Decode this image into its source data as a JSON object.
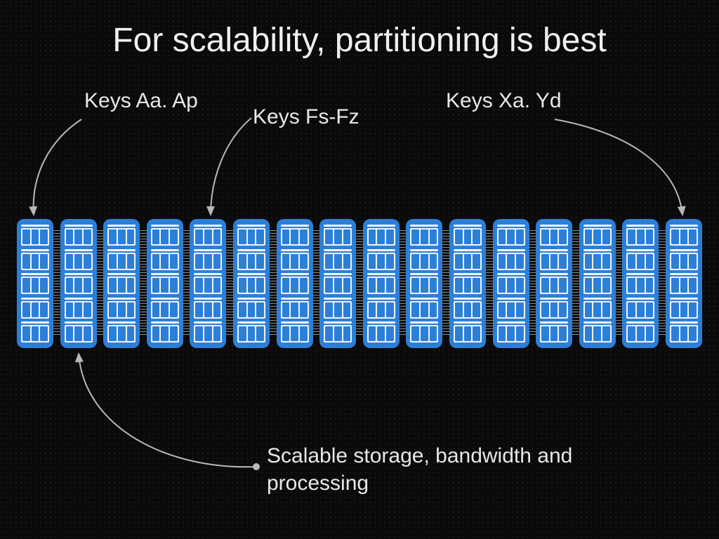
{
  "title": "For scalability, partitioning is best",
  "labels": {
    "l1": "Keys Aa. Ap",
    "l2": "Keys Fs-Fz",
    "l3": "Keys Xa. Yd"
  },
  "caption": "Scalable storage, bandwidth and processing",
  "rack_count": 16,
  "units_per_rack": 5,
  "bays_per_unit": 3,
  "colors": {
    "rack": "#2c7fd8",
    "panel": "#eef4fb",
    "arrow": "#b8b8b8"
  },
  "chart_data": {
    "type": "table",
    "description": "Key-range partitioning across a row of storage racks",
    "partitions": [
      {
        "label": "Keys Aa. Ap",
        "target_rack_index": 0
      },
      {
        "label": "Keys Fs-Fz",
        "target_rack_index": 4
      },
      {
        "label": "Keys Xa. Yd",
        "target_rack_index": 15
      }
    ],
    "annotation": {
      "text": "Scalable storage, bandwidth and processing",
      "points_to_rack_index": 1
    },
    "racks": 16
  }
}
